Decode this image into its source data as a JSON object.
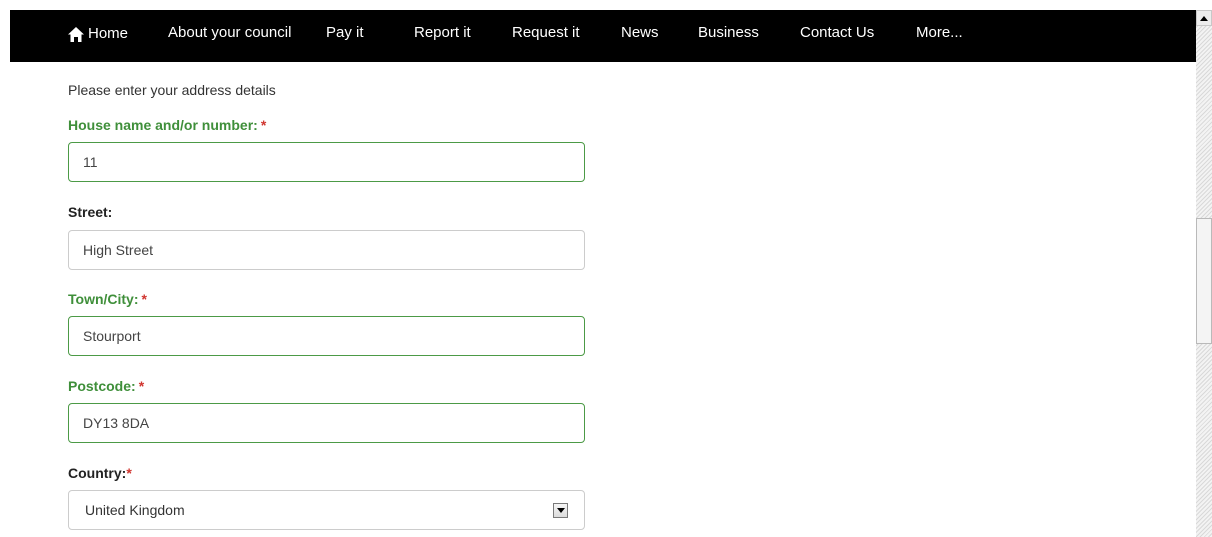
{
  "nav": {
    "home": "Home",
    "about": "About your council",
    "pay": "Pay it",
    "report": "Report it",
    "request": "Request it",
    "news": "News",
    "business": "Business",
    "contact": "Contact Us",
    "more": "More..."
  },
  "form": {
    "intro": "Please enter your address details",
    "house": {
      "label": "House name and/or number:",
      "required_mark": "*",
      "value": "11"
    },
    "street": {
      "label": "Street:",
      "value": "High Street"
    },
    "town": {
      "label": "Town/City:",
      "required_mark": "*",
      "value": "Stourport"
    },
    "postcode": {
      "label": "Postcode:",
      "required_mark": "*",
      "value": "DY13 8DA"
    },
    "country": {
      "label": "Country:",
      "required_mark": "*",
      "selected": "United Kingdom"
    }
  },
  "colors": {
    "nav_background": "#000000",
    "valid_green": "#3f8f3a",
    "required_red": "#d0352f"
  },
  "icons": {
    "home": "home-icon",
    "scroll_up": "arrow-up-icon",
    "dropdown": "chevron-down-icon"
  }
}
